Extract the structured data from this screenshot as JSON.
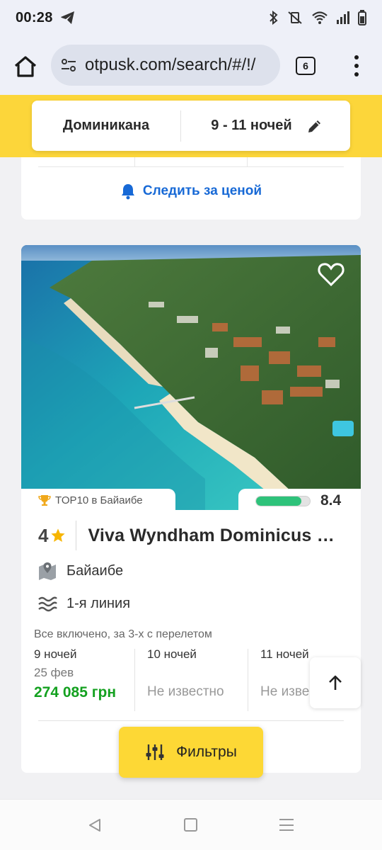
{
  "status_bar": {
    "time": "00:28"
  },
  "browser": {
    "url": "otpusk.com/search/#/!/",
    "tab_count": "6"
  },
  "search_summary": {
    "destination": "Доминикана",
    "nights": "9 - 11 ночей"
  },
  "previous_card": {
    "watch_price_label": "Следить за ценой"
  },
  "hotel": {
    "top10_label": "TOP10 в Байаибе",
    "rating": "8.4",
    "rating_fraction": 0.84,
    "stars": "4",
    "name": "Viva Wyndham Dominicus Palace",
    "location": "Байаибе",
    "beach_line": "1-я линия",
    "meal_info": "Все включено, за 3-х с перелетом",
    "offers": [
      {
        "nights": "9 ночей",
        "date": "25 фев",
        "price": "274 085 грн"
      },
      {
        "nights": "10 ночей",
        "date": "",
        "unknown": "Не известно"
      },
      {
        "nights": "11 ночей",
        "date": "",
        "unknown": "Не известно"
      }
    ]
  },
  "filters_label": "Фильтры",
  "colors": {
    "accent_yellow": "#fcd63a",
    "price_green": "#14a120",
    "link_blue": "#1769d6",
    "rating_green": "#2ec27a"
  }
}
